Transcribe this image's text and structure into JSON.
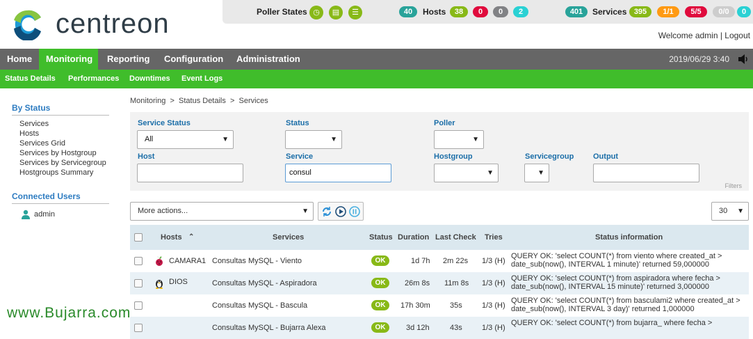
{
  "header": {
    "logo_text": "centreon",
    "poller_states_label": "Poller States",
    "hosts": {
      "label": "Hosts",
      "total": "40",
      "up": "38",
      "down": "0",
      "unreachable": "0",
      "pending": "2"
    },
    "services": {
      "label": "Services",
      "total": "401",
      "ok": "395",
      "warning": "1/1",
      "critical": "5/5",
      "unknown": "0/0",
      "pending": "0"
    },
    "welcome": "Welcome admin | Logout"
  },
  "nav": {
    "items": [
      "Home",
      "Monitoring",
      "Reporting",
      "Configuration",
      "Administration"
    ],
    "active": "Monitoring",
    "datetime": "2019/06/29 3:40"
  },
  "subnav": {
    "items": [
      "Status Details",
      "Performances",
      "Downtimes",
      "Event Logs"
    ]
  },
  "sidebar": {
    "by_status_title": "By Status",
    "links": [
      "Services",
      "Hosts",
      "Services Grid",
      "Services by Hostgroup",
      "Services by Servicegroup",
      "Hostgroups Summary"
    ],
    "connected_title": "Connected Users",
    "user": "admin"
  },
  "breadcrumb": "Monitoring  >  Status Details  >  Services",
  "filters": {
    "service_status_label": "Service Status",
    "service_status_value": "All",
    "status_label": "Status",
    "status_value": "",
    "poller_label": "Poller",
    "poller_value": "",
    "host_label": "Host",
    "host_value": "",
    "service_label": "Service",
    "service_value": "consul",
    "hostgroup_label": "Hostgroup",
    "hostgroup_value": "",
    "servicegroup_label": "Servicegroup",
    "servicegroup_value": "",
    "output_label": "Output",
    "output_value": "",
    "filters_caption": "Filters"
  },
  "toolbar": {
    "more_actions": "More actions...",
    "page_size": "30"
  },
  "table": {
    "headers": {
      "hosts": "Hosts",
      "services": "Services",
      "status": "Status",
      "duration": "Duration",
      "last_check": "Last Check",
      "tries": "Tries",
      "info": "Status information"
    },
    "rows": [
      {
        "host": "CAMARA1",
        "service": "Consultas MySQL - Viento",
        "status": "OK",
        "duration": "1d 7h",
        "last_check": "2m 22s",
        "tries": "1/3 (H)",
        "info": "QUERY OK: 'select COUNT(*) from viento where created_at > date_sub(now(), INTERVAL 1 minute)' returned 59,000000",
        "os": "raspberry-icon"
      },
      {
        "host": "DIOS",
        "service": "Consultas MySQL - Aspiradora",
        "status": "OK",
        "duration": "26m 8s",
        "last_check": "11m 8s",
        "tries": "1/3 (H)",
        "info": "QUERY OK: 'select COUNT(*) from aspiradora where fecha > date_sub(now(), INTERVAL 15 minute)' returned 3,000000",
        "os": "linux-icon"
      },
      {
        "host": "",
        "service": "Consultas MySQL - Bascula",
        "status": "OK",
        "duration": "17h 30m",
        "last_check": "35s",
        "tries": "1/3 (H)",
        "info": "QUERY OK: 'select COUNT(*) from basculami2 where created_at > date_sub(now(), INTERVAL 3 day)' returned 1,000000",
        "os": ""
      },
      {
        "host": "",
        "service": "Consultas MySQL - Bujarra Alexa",
        "status": "OK",
        "duration": "3d 12h",
        "last_check": "43s",
        "tries": "1/3 (H)",
        "info": "QUERY OK: 'select COUNT(*) from bujarra_        where fecha >",
        "os": ""
      }
    ]
  },
  "watermark": "www.Bujarra.com",
  "colors": {
    "green": "#40bd2b",
    "nav": "#666666",
    "ok": "#88b917",
    "teal": "#29a39a",
    "red": "#e00b3d"
  }
}
